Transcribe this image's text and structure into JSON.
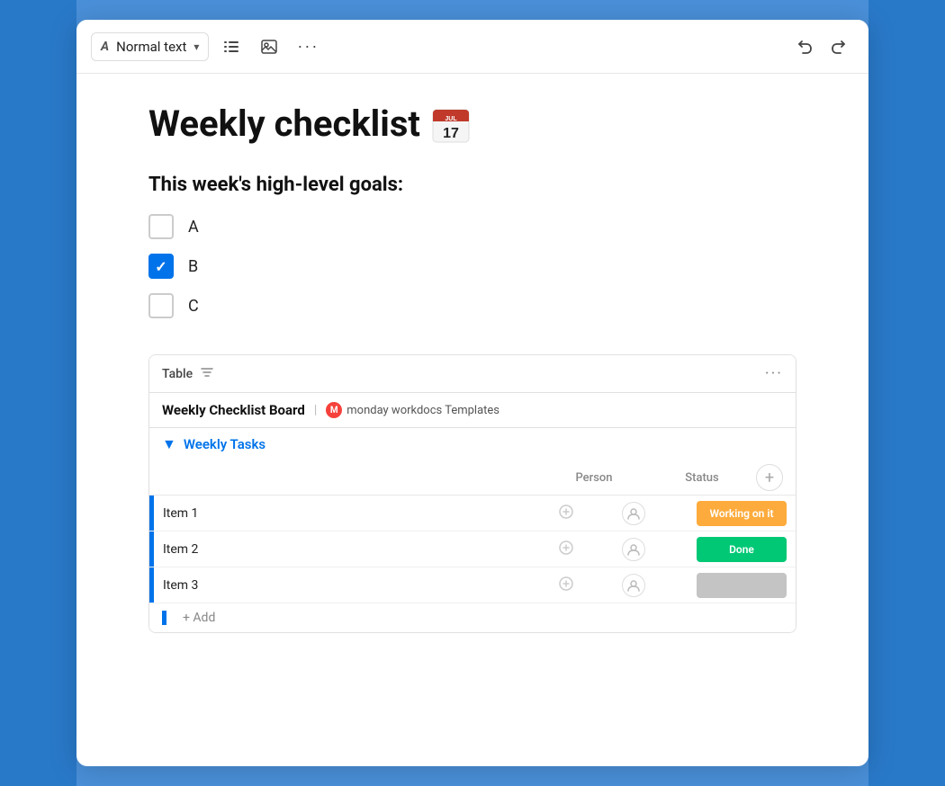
{
  "toolbar": {
    "text_format_label": "Normal text",
    "text_format_icon": "A",
    "list_icon": "≡",
    "image_icon": "⊡",
    "more_icon": "···",
    "undo_icon": "↩",
    "redo_icon": "↪"
  },
  "editor": {
    "title": "Weekly checklist",
    "title_emoji": "📅",
    "section_heading": "This week's high-level goals:",
    "checklist": [
      {
        "id": "a",
        "label": "A",
        "checked": false
      },
      {
        "id": "b",
        "label": "B",
        "checked": true
      },
      {
        "id": "c",
        "label": "C",
        "checked": false
      }
    ]
  },
  "table_widget": {
    "label": "Table",
    "filter_icon": "⊳",
    "more_icon": "···",
    "board_title": "Weekly Checklist Board",
    "separator": "|",
    "source_label": "monday workdocs Templates",
    "group_name": "Weekly Tasks",
    "col_person": "Person",
    "col_status": "Status",
    "items": [
      {
        "name": "Item 1",
        "person": null,
        "status": "Working on it",
        "status_type": "working"
      },
      {
        "name": "Item 2",
        "person": null,
        "status": "Done",
        "status_type": "done"
      },
      {
        "name": "Item 3",
        "person": null,
        "status": "",
        "status_type": "empty"
      }
    ],
    "add_label": "+ Add"
  },
  "colors": {
    "accent_blue": "#0073ea",
    "status_working": "#fdab3d",
    "status_done": "#00c875",
    "status_empty": "#c4c4c4"
  }
}
